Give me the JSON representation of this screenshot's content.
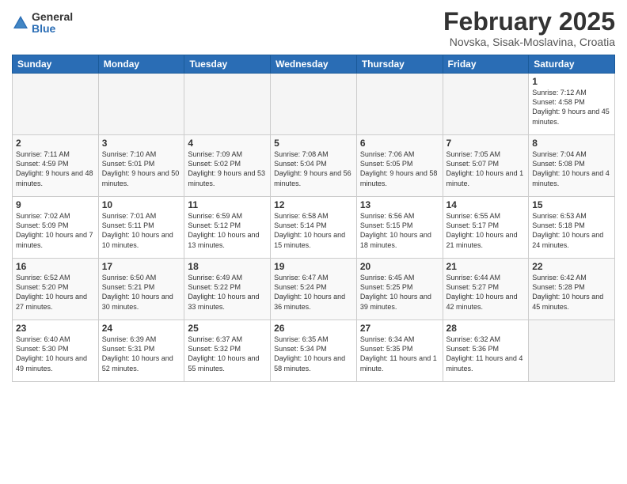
{
  "header": {
    "logo_general": "General",
    "logo_blue": "Blue",
    "month_title": "February 2025",
    "location": "Novska, Sisak-Moslavina, Croatia"
  },
  "days_of_week": [
    "Sunday",
    "Monday",
    "Tuesday",
    "Wednesday",
    "Thursday",
    "Friday",
    "Saturday"
  ],
  "weeks": [
    [
      {
        "day": "",
        "info": ""
      },
      {
        "day": "",
        "info": ""
      },
      {
        "day": "",
        "info": ""
      },
      {
        "day": "",
        "info": ""
      },
      {
        "day": "",
        "info": ""
      },
      {
        "day": "",
        "info": ""
      },
      {
        "day": "1",
        "info": "Sunrise: 7:12 AM\nSunset: 4:58 PM\nDaylight: 9 hours and 45 minutes."
      }
    ],
    [
      {
        "day": "2",
        "info": "Sunrise: 7:11 AM\nSunset: 4:59 PM\nDaylight: 9 hours and 48 minutes."
      },
      {
        "day": "3",
        "info": "Sunrise: 7:10 AM\nSunset: 5:01 PM\nDaylight: 9 hours and 50 minutes."
      },
      {
        "day": "4",
        "info": "Sunrise: 7:09 AM\nSunset: 5:02 PM\nDaylight: 9 hours and 53 minutes."
      },
      {
        "day": "5",
        "info": "Sunrise: 7:08 AM\nSunset: 5:04 PM\nDaylight: 9 hours and 56 minutes."
      },
      {
        "day": "6",
        "info": "Sunrise: 7:06 AM\nSunset: 5:05 PM\nDaylight: 9 hours and 58 minutes."
      },
      {
        "day": "7",
        "info": "Sunrise: 7:05 AM\nSunset: 5:07 PM\nDaylight: 10 hours and 1 minute."
      },
      {
        "day": "8",
        "info": "Sunrise: 7:04 AM\nSunset: 5:08 PM\nDaylight: 10 hours and 4 minutes."
      }
    ],
    [
      {
        "day": "9",
        "info": "Sunrise: 7:02 AM\nSunset: 5:09 PM\nDaylight: 10 hours and 7 minutes."
      },
      {
        "day": "10",
        "info": "Sunrise: 7:01 AM\nSunset: 5:11 PM\nDaylight: 10 hours and 10 minutes."
      },
      {
        "day": "11",
        "info": "Sunrise: 6:59 AM\nSunset: 5:12 PM\nDaylight: 10 hours and 13 minutes."
      },
      {
        "day": "12",
        "info": "Sunrise: 6:58 AM\nSunset: 5:14 PM\nDaylight: 10 hours and 15 minutes."
      },
      {
        "day": "13",
        "info": "Sunrise: 6:56 AM\nSunset: 5:15 PM\nDaylight: 10 hours and 18 minutes."
      },
      {
        "day": "14",
        "info": "Sunrise: 6:55 AM\nSunset: 5:17 PM\nDaylight: 10 hours and 21 minutes."
      },
      {
        "day": "15",
        "info": "Sunrise: 6:53 AM\nSunset: 5:18 PM\nDaylight: 10 hours and 24 minutes."
      }
    ],
    [
      {
        "day": "16",
        "info": "Sunrise: 6:52 AM\nSunset: 5:20 PM\nDaylight: 10 hours and 27 minutes."
      },
      {
        "day": "17",
        "info": "Sunrise: 6:50 AM\nSunset: 5:21 PM\nDaylight: 10 hours and 30 minutes."
      },
      {
        "day": "18",
        "info": "Sunrise: 6:49 AM\nSunset: 5:22 PM\nDaylight: 10 hours and 33 minutes."
      },
      {
        "day": "19",
        "info": "Sunrise: 6:47 AM\nSunset: 5:24 PM\nDaylight: 10 hours and 36 minutes."
      },
      {
        "day": "20",
        "info": "Sunrise: 6:45 AM\nSunset: 5:25 PM\nDaylight: 10 hours and 39 minutes."
      },
      {
        "day": "21",
        "info": "Sunrise: 6:44 AM\nSunset: 5:27 PM\nDaylight: 10 hours and 42 minutes."
      },
      {
        "day": "22",
        "info": "Sunrise: 6:42 AM\nSunset: 5:28 PM\nDaylight: 10 hours and 45 minutes."
      }
    ],
    [
      {
        "day": "23",
        "info": "Sunrise: 6:40 AM\nSunset: 5:30 PM\nDaylight: 10 hours and 49 minutes."
      },
      {
        "day": "24",
        "info": "Sunrise: 6:39 AM\nSunset: 5:31 PM\nDaylight: 10 hours and 52 minutes."
      },
      {
        "day": "25",
        "info": "Sunrise: 6:37 AM\nSunset: 5:32 PM\nDaylight: 10 hours and 55 minutes."
      },
      {
        "day": "26",
        "info": "Sunrise: 6:35 AM\nSunset: 5:34 PM\nDaylight: 10 hours and 58 minutes."
      },
      {
        "day": "27",
        "info": "Sunrise: 6:34 AM\nSunset: 5:35 PM\nDaylight: 11 hours and 1 minute."
      },
      {
        "day": "28",
        "info": "Sunrise: 6:32 AM\nSunset: 5:36 PM\nDaylight: 11 hours and 4 minutes."
      },
      {
        "day": "",
        "info": ""
      }
    ]
  ]
}
